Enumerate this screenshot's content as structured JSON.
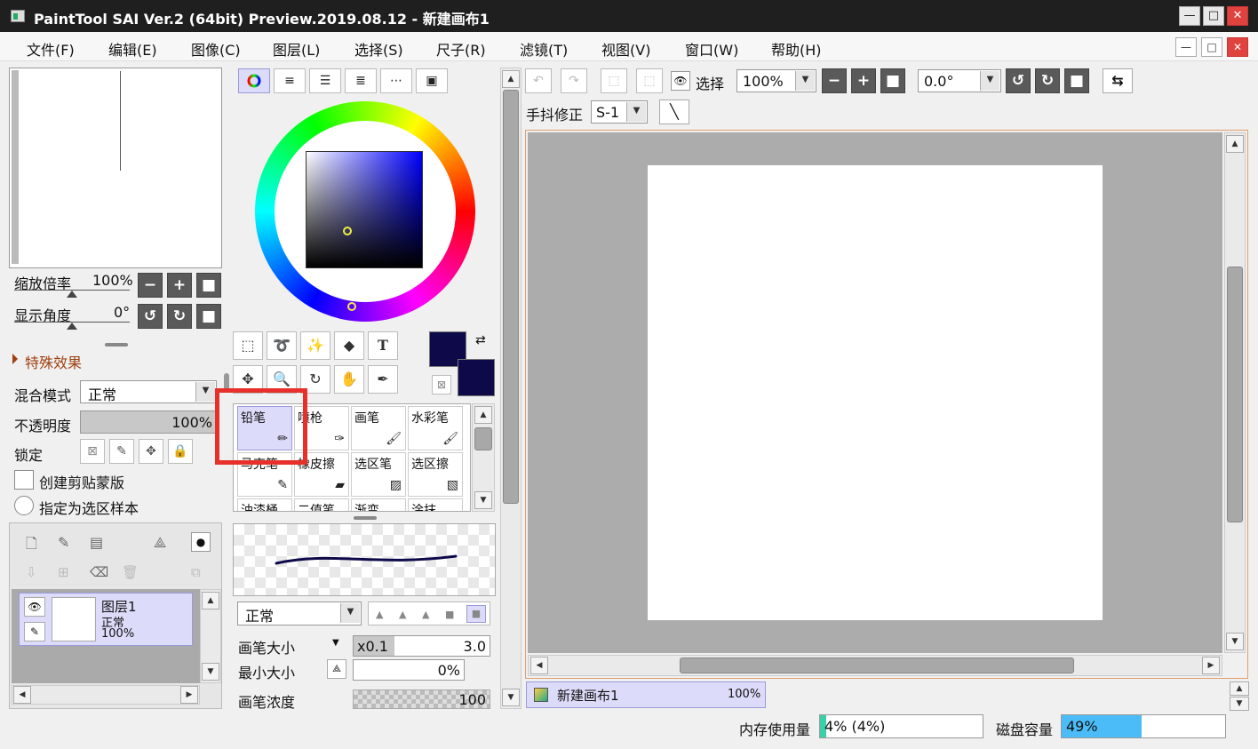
{
  "window": {
    "title": "PaintTool SAI Ver.2 (64bit) Preview.2019.08.12 - 新建画布1",
    "min": "—",
    "max": "□",
    "close": "✕"
  },
  "menu": [
    "文件(F)",
    "编辑(E)",
    "图像(C)",
    "图层(L)",
    "选择(S)",
    "尺子(R)",
    "滤镜(T)",
    "视图(V)",
    "窗口(W)",
    "帮助(H)"
  ],
  "navigator": {
    "zoom_label": "缩放倍率",
    "zoom_value": "100%",
    "angle_label": "显示角度",
    "angle_value": "0°",
    "effects_label": "特殊效果"
  },
  "layer_props": {
    "blend_label": "混合模式",
    "blend_value": "正常",
    "opacity_label": "不透明度",
    "opacity_value": "100%",
    "lock_label": "锁定",
    "clip_label": "创建剪贴蒙版",
    "sample_label": "指定为选区样本"
  },
  "layers": [
    {
      "name": "图层1",
      "mode": "正常",
      "opacity": "100%"
    }
  ],
  "colors": {
    "primary": "#0e0a4a",
    "secondary": "#0e0a4a",
    "accent_highlight": "#e8302a",
    "canvas_bg": "#acacac",
    "selected_bg": "#dcdcfa"
  },
  "brushes": [
    {
      "name": "铅笔",
      "icon": "pencil-icon"
    },
    {
      "name": "喷枪",
      "icon": "airbrush-icon"
    },
    {
      "name": "画笔",
      "icon": "brush-icon"
    },
    {
      "name": "水彩笔",
      "icon": "watercolor-icon"
    },
    {
      "name": "马克笔",
      "icon": "marker-icon"
    },
    {
      "name": "橡皮擦",
      "icon": "eraser-icon"
    },
    {
      "name": "选区笔",
      "icon": "select-pen-icon"
    },
    {
      "name": "选区擦",
      "icon": "select-eraser-icon"
    },
    {
      "name": "油漆桶",
      "icon": "bucket-icon"
    },
    {
      "name": "二值笔",
      "icon": "binary-pen-icon"
    },
    {
      "name": "渐变",
      "icon": "gradient-icon"
    },
    {
      "name": "涂抹",
      "icon": "smudge-icon"
    }
  ],
  "brush_settings": {
    "mode_value": "正常",
    "size_label": "画笔大小",
    "size_mult": "x0.1",
    "size_value": "3.0",
    "min_label": "最小大小",
    "min_value": "0%",
    "density_label": "画笔浓度",
    "density_value": "100"
  },
  "canvas_toolbar": {
    "select_label": "选择",
    "zoom_value": "100%",
    "angle_value": "0.0°",
    "stabilizer_label": "手抖修正",
    "stabilizer_value": "S-1"
  },
  "canvas_tab": {
    "name": "新建画布1",
    "zoom": "100%"
  },
  "status": {
    "memory_label": "内存使用量",
    "memory_value": "4% (4%)",
    "memory_fraction": 0.04,
    "disk_label": "磁盘容量",
    "disk_value": "49%",
    "disk_fraction": 0.49
  }
}
